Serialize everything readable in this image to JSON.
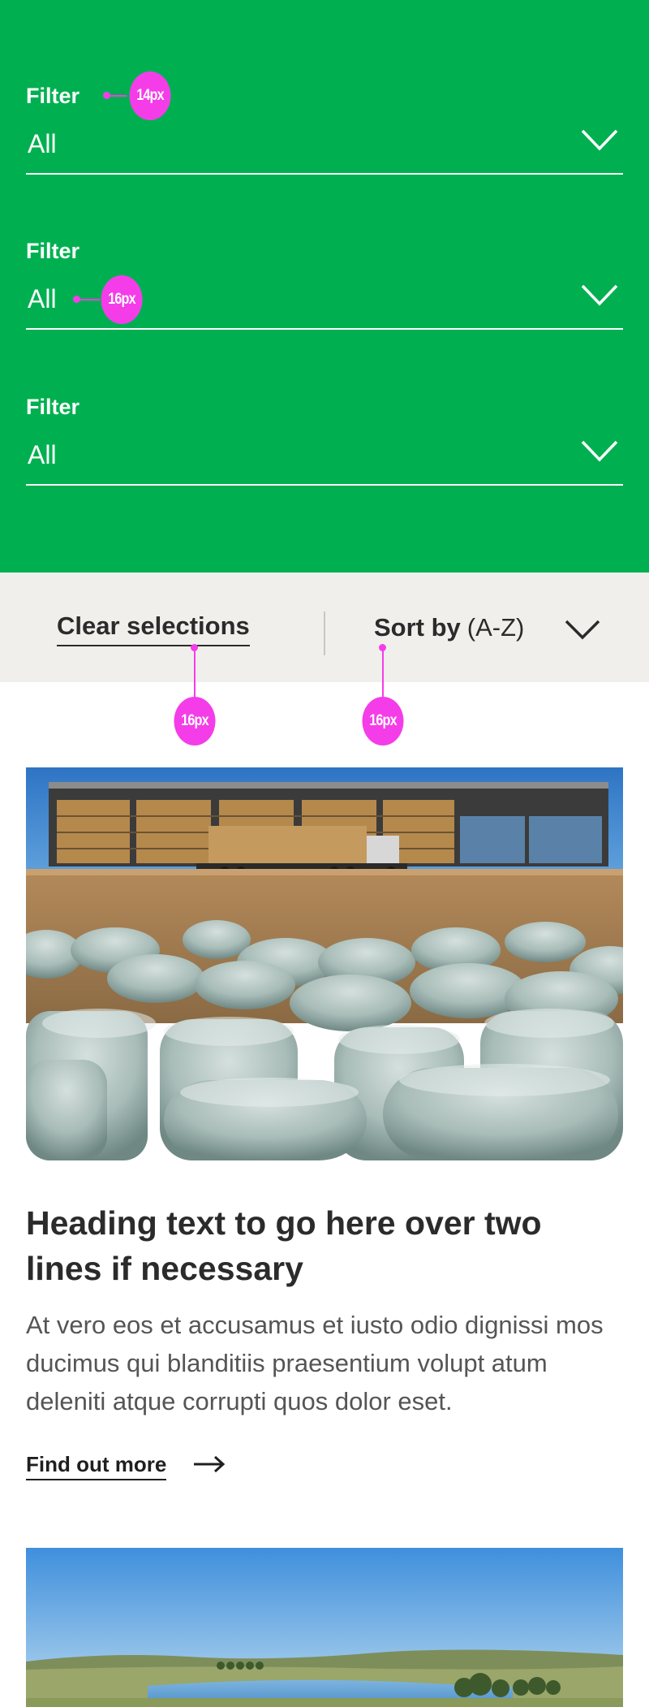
{
  "filters": [
    {
      "label": "Filter",
      "value": "All",
      "icon": "chevron-down-icon"
    },
    {
      "label": "Filter",
      "value": "All",
      "icon": "chevron-down-icon"
    },
    {
      "label": "Filter",
      "value": "All",
      "icon": "chevron-down-icon"
    }
  ],
  "annotations": {
    "filter_label_size": "14px",
    "filter_value_size": "16px",
    "clear_size": "16px",
    "sort_size": "16px"
  },
  "actions": {
    "clear_label": "Clear selections",
    "sort_label": "Sort by",
    "sort_value": "(A-Z)",
    "sort_icon": "chevron-down-icon"
  },
  "cards": [
    {
      "image": "hay-bales-photo",
      "title": "Heading text to go here over two lines if necessary",
      "body": "At vero eos et accusamus et iusto odio dignissi mos ducimus qui blanditiis praesentium volupt atum deleniti atque corrupti quos dolor eset.",
      "link_label": "Find out more",
      "link_icon": "arrow-right-icon"
    },
    {
      "image": "lake-landscape-photo"
    }
  ],
  "colors": {
    "filter_panel": "#00b050",
    "action_bar": "#f1efec",
    "annotation": "#f43de8",
    "text_dark": "#2b2b2b"
  }
}
